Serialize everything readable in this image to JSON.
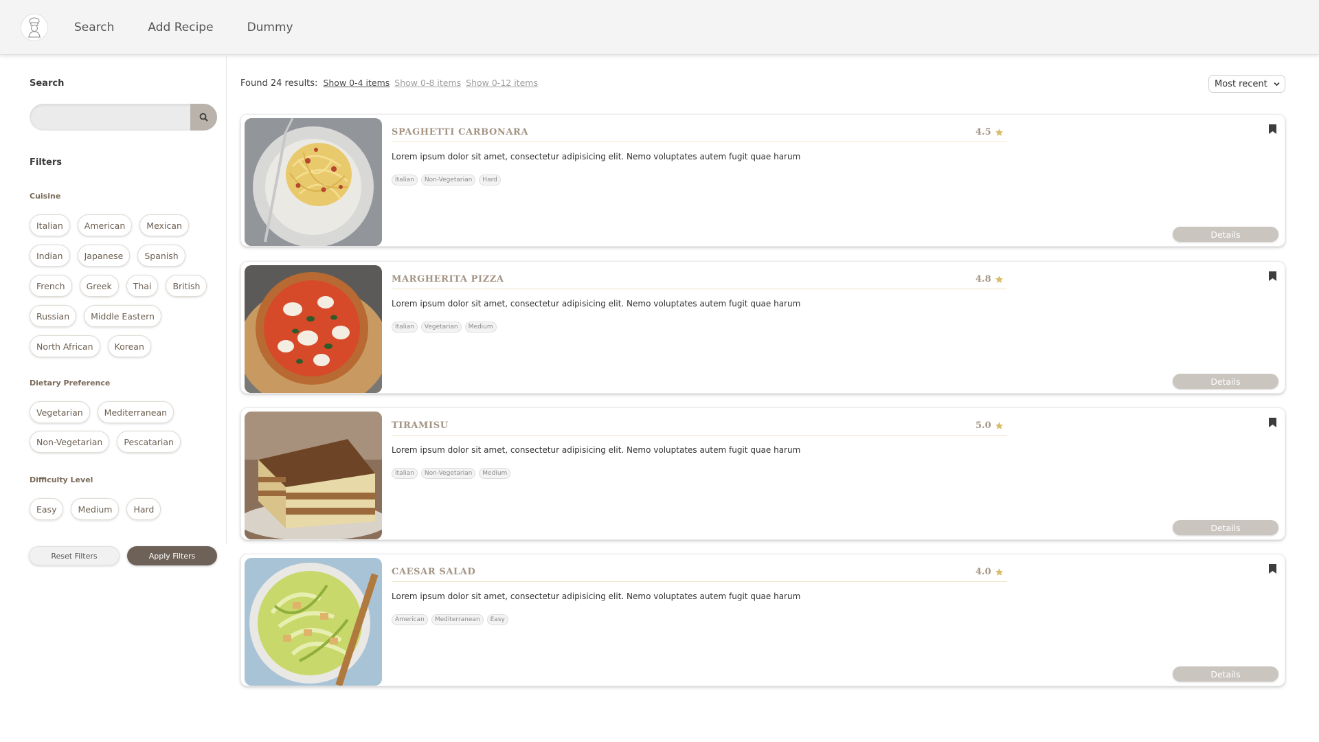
{
  "nav": {
    "logo_icon": "chef-logo-icon",
    "links": [
      "Search",
      "Add Recipe",
      "Dummy"
    ]
  },
  "sidebar": {
    "search_heading": "Search",
    "search_value": "",
    "search_icon": "search-icon",
    "filters_heading": "Filters",
    "cuisine": {
      "title": "Cuisine",
      "options": [
        "Italian",
        "American",
        "Mexican",
        "Indian",
        "Japanese",
        "Spanish",
        "French",
        "Greek",
        "Thai",
        "British",
        "Russian",
        "Middle Eastern",
        "North African",
        "Korean"
      ]
    },
    "dietary": {
      "title": "Dietary Preference",
      "options": [
        "Vegetarian",
        "Mediterranean",
        "Non-Vegetarian",
        "Pescatarian"
      ]
    },
    "difficulty": {
      "title": "Difficulty Level",
      "options": [
        "Easy",
        "Medium",
        "Hard"
      ]
    },
    "reset_label": "Reset Filters",
    "apply_label": "Apply Filters"
  },
  "results": {
    "count_text": "Found 24 results:",
    "show_options": [
      "Show 0-4 items",
      "Show 0-8 items",
      "Show 0-12 items"
    ],
    "active_show": "Show 0-4 items",
    "sort_value": "Most recent"
  },
  "recipes": [
    {
      "title": "SPAGHETTI CARBONARA",
      "rating": "4.5",
      "description": "Lorem ipsum dolor sit amet, consectetur adipisicing elit. Nemo voluptates autem fugit quae harum",
      "tags": [
        "Italian",
        "Non-Vegetarian",
        "Hard"
      ],
      "details_label": "Details"
    },
    {
      "title": "MARGHERITA PIZZA",
      "rating": "4.8",
      "description": "Lorem ipsum dolor sit amet, consectetur adipisicing elit. Nemo voluptates autem fugit quae harum",
      "tags": [
        "Italian",
        "Vegetarian",
        "Medium"
      ],
      "details_label": "Details"
    },
    {
      "title": "TIRAMISU",
      "rating": "5.0",
      "description": "Lorem ipsum dolor sit amet, consectetur adipisicing elit. Nemo voluptates autem fugit quae harum",
      "tags": [
        "Italian",
        "Non-Vegetarian",
        "Medium"
      ],
      "details_label": "Details"
    },
    {
      "title": "CAESAR SALAD",
      "rating": "4.0",
      "description": "Lorem ipsum dolor sit amet, consectetur adipisicing elit. Nemo voluptates autem fugit quae harum",
      "tags": [
        "American",
        "Mediterranean",
        "Easy"
      ],
      "details_label": "Details"
    }
  ],
  "colors": {
    "accent_dark": "#6e6158",
    "title_tan": "#a39484",
    "star_gold": "#d8be6a",
    "details_btn": "#cac5bf"
  }
}
